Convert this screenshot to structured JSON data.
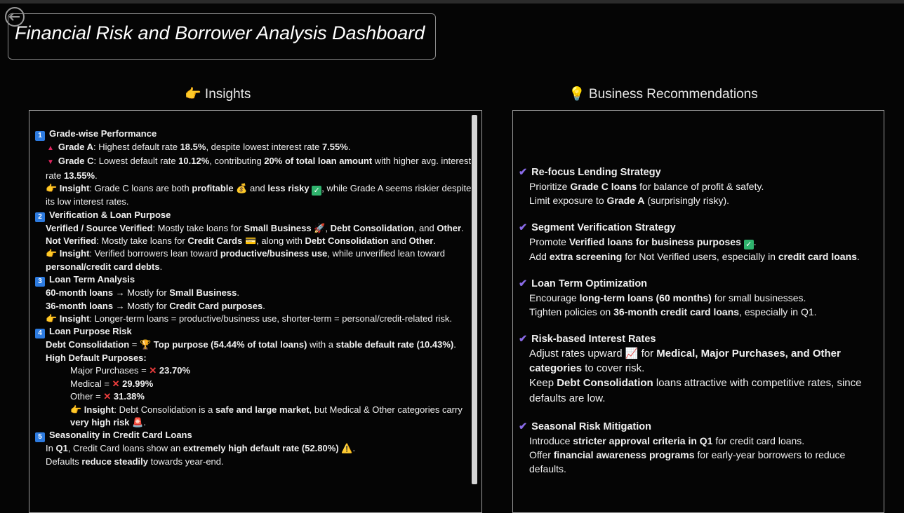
{
  "header": {
    "title": "Financial Risk and Borrower Analysis Dashboard"
  },
  "insights": {
    "heading": "👉 Insights",
    "s1": {
      "num": "1",
      "title": "Grade-wise Performance",
      "a_label": "Grade A",
      "a_t1": ": Highest default rate ",
      "a_v1": "18.5%",
      "a_t2": ", despite lowest interest rate ",
      "a_v2": "7.55%",
      "a_t3": ".",
      "c_label": "Grade C",
      "c_t1": ": Lowest default rate ",
      "c_v1": "10.12%",
      "c_t2": ", contributing ",
      "c_v2": "20% of total loan amount",
      "c_t3": " with higher avg. interest rate ",
      "c_v3": "13.55%",
      "c_t4": ".",
      "ins_label": "👉 Insight",
      "ins_t1": ": Grade C loans are both ",
      "ins_v1": "profitable",
      "ins_t2": " 💰 and ",
      "ins_v2": "less risky",
      "ins_t3": ", while Grade A seems riskier despite its low interest rates."
    },
    "s2": {
      "num": "2",
      "title": "Verification & Loan Purpose",
      "v_label": "Verified / Source Verified",
      "v_t1": ": Mostly take loans for ",
      "v_v1": "Small Business",
      "v_t2": " 🚀, ",
      "v_v2": "Debt Consolidation",
      "v_t3": ", and ",
      "v_v3": "Other",
      "v_t4": ".",
      "n_label": "Not Verified",
      "n_t1": ": Mostly take loans for ",
      "n_v1": "Credit Cards",
      "n_t2": " 💳, along with ",
      "n_v2": "Debt Consolidation",
      "n_t3": " and ",
      "n_v3": "Other",
      "n_t4": ".",
      "ins_label": "👉 Insight",
      "ins_t1": ": Verified borrowers lean toward ",
      "ins_v1": "productive/business use",
      "ins_t2": ", while unverified lean toward ",
      "ins_v2": "personal/credit card debts",
      "ins_t3": "."
    },
    "s3": {
      "num": "3",
      "title": "Loan Term Analysis",
      "l1_label": "60-month loans",
      "l1_t1": " → Mostly for ",
      "l1_v1": "Small Business",
      "l1_t2": ".",
      "l2_label": "36-month loans",
      "l2_t1": " → Mostly for ",
      "l2_v1": "Credit Card purposes",
      "l2_t2": ".",
      "ins_label": "👉 Insight",
      "ins_t1": ": Longer-term loans = productive/business use, shorter-term = personal/credit-related risk."
    },
    "s4": {
      "num": "4",
      "title": "Loan Purpose Risk",
      "d_label": "Debt Consolidation",
      "d_t1": " = 🏆 ",
      "d_v1": "Top purpose (54.44% of total loans)",
      "d_t2": " with a ",
      "d_v2": "stable default rate",
      "d_v3": "(10.43%)",
      "d_t3": ".",
      "hd_label": "High Default Purposes",
      "hd_colon": ":",
      "items": [
        {
          "name": "Major Purchases",
          "eq": " = ",
          "value": "23.70%"
        },
        {
          "name": "Medical",
          "eq": " = ",
          "value": "29.99%"
        },
        {
          "name": "Other",
          "eq": " = ",
          "value": "31.38%"
        }
      ],
      "ins_label": "👉 Insight",
      "ins_t1": ": Debt Consolidation is a ",
      "ins_v1": "safe and large market",
      "ins_t2": ", but Medical & Other categories carry ",
      "ins_v2": "very high risk",
      "ins_t3": " 🚨."
    },
    "s5": {
      "num": "5",
      "title": "Seasonality in Credit Card Loans",
      "l1_t1": "In ",
      "l1_v1": "Q1",
      "l1_t2": ", Credit Card loans show an ",
      "l1_v2": "extremely high default rate (52.80%)",
      "l1_t3": " ⚠️.",
      "l2_t1": "Defaults ",
      "l2_v1": "reduce steadily",
      "l2_t2": " towards year-end."
    }
  },
  "recommendations": {
    "heading": "💡 Business Recommendations",
    "r1": {
      "title": "Re-focus Lending Strategy",
      "l1_t1": "Prioritize ",
      "l1_v1": "Grade C loans",
      "l1_t2": " for balance of profit & safety.",
      "l2_t1": "Limit exposure to ",
      "l2_v1": "Grade A",
      "l2_t2": " (surprisingly risky)."
    },
    "r2": {
      "title": "Segment Verification Strategy",
      "l1_t1": "Promote ",
      "l1_v1": "Verified loans for business purposes",
      "l1_t2": ".",
      "l2_t1": "Add ",
      "l2_v1": "extra screening",
      "l2_t2": " for Not Verified users, especially in ",
      "l2_v2": "credit card loans",
      "l2_t3": "."
    },
    "r3": {
      "title": "Loan Term Optimization",
      "l1_t1": "Encourage ",
      "l1_v1": "long-term loans (60 months)",
      "l1_t2": " for small businesses.",
      "l2_t1": "Tighten policies on ",
      "l2_v1": "36-month credit card loans",
      "l2_t2": ", especially in Q1."
    },
    "r4": {
      "title": "Risk-based Interest Rates",
      "l1_t1": "Adjust rates upward 📈 for ",
      "l1_v1": "Medical, Major Purchases, and Other categories",
      "l1_t2": " to cover risk.",
      "l2_t1": "Keep ",
      "l2_v1": "Debt Consolidation",
      "l2_t2": " loans attractive with competitive rates, since defaults are low."
    },
    "r5": {
      "title": "Seasonal Risk Mitigation",
      "l1_t1": "Introduce ",
      "l1_v1": "stricter approval criteria in Q1",
      "l1_t2": " for credit card loans.",
      "l2_t1": "Offer ",
      "l2_v1": "financial awareness programs",
      "l2_t2": " for early-year borrowers to reduce defaults."
    }
  }
}
